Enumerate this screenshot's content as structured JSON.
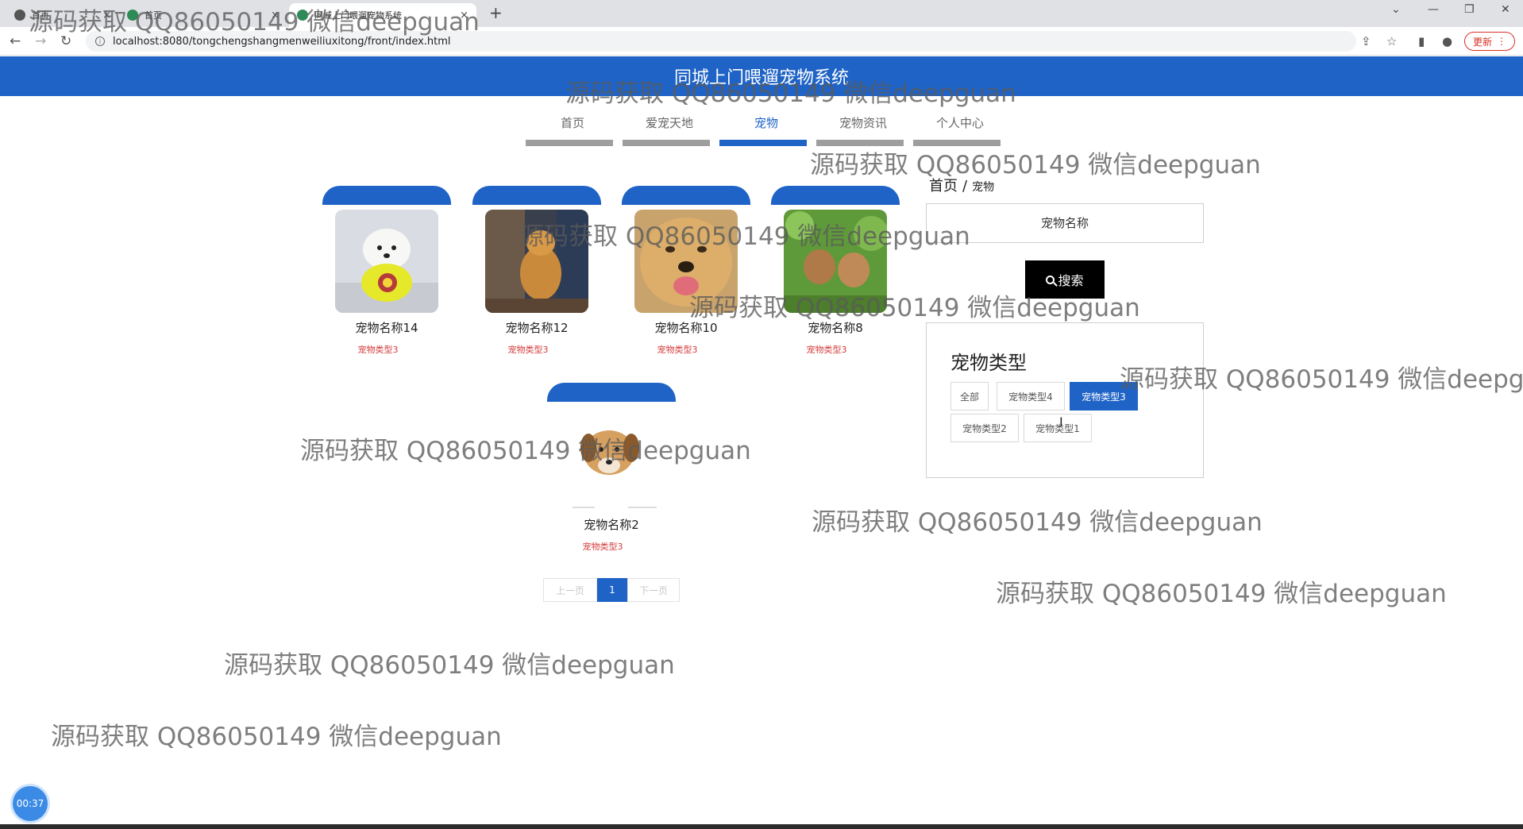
{
  "browser": {
    "tabs": [
      {
        "title": "首页",
        "close": "×"
      },
      {
        "title": "首页",
        "close": "×"
      },
      {
        "title": "同城上门喂遛宠物系统",
        "close": "×"
      }
    ],
    "new_tab": "+",
    "url": "localhost:8080/tongchengshangmenweiliuxitong/front/index.html",
    "update_label": "更新"
  },
  "site": {
    "title": "同城上门喂遛宠物系统",
    "nav": [
      "首页",
      "爱宠天地",
      "宠物",
      "宠物资讯",
      "个人中心"
    ],
    "active_nav": "宠物"
  },
  "pets": [
    {
      "name": "宠物名称14",
      "type": "宠物类型3",
      "image": "white-dog-in-yellow-shirt"
    },
    {
      "name": "宠物名称12",
      "type": "宠物类型3",
      "image": "golden-dog-indoors"
    },
    {
      "name": "宠物名称10",
      "type": "宠物类型3",
      "image": "golden-retriever-face"
    },
    {
      "name": "宠物名称8",
      "type": "宠物类型3",
      "image": "puppies-on-grass"
    },
    {
      "name": "宠物名称2",
      "type": "宠物类型3",
      "image": "puppy-lying"
    }
  ],
  "breadcrumb": {
    "home": "首页",
    "separator": "/",
    "current": "宠物"
  },
  "search": {
    "placeholder": "宠物名称",
    "button_label": "搜索"
  },
  "pet_types": {
    "title": "宠物类型",
    "items": [
      "全部",
      "宠物类型4",
      "宠物类型3",
      "宠物类型2",
      "宠物类型1"
    ],
    "active": "宠物类型3"
  },
  "pagination": {
    "prev": "上一页",
    "current": "1",
    "next": "下一页"
  },
  "watermark": "源码获取 QQ86050149 微信deepguan",
  "timer": "00:37",
  "colors": {
    "brand": "#1f63c6",
    "search_button": "#000000",
    "pet_type_text": "#d43b3b"
  }
}
